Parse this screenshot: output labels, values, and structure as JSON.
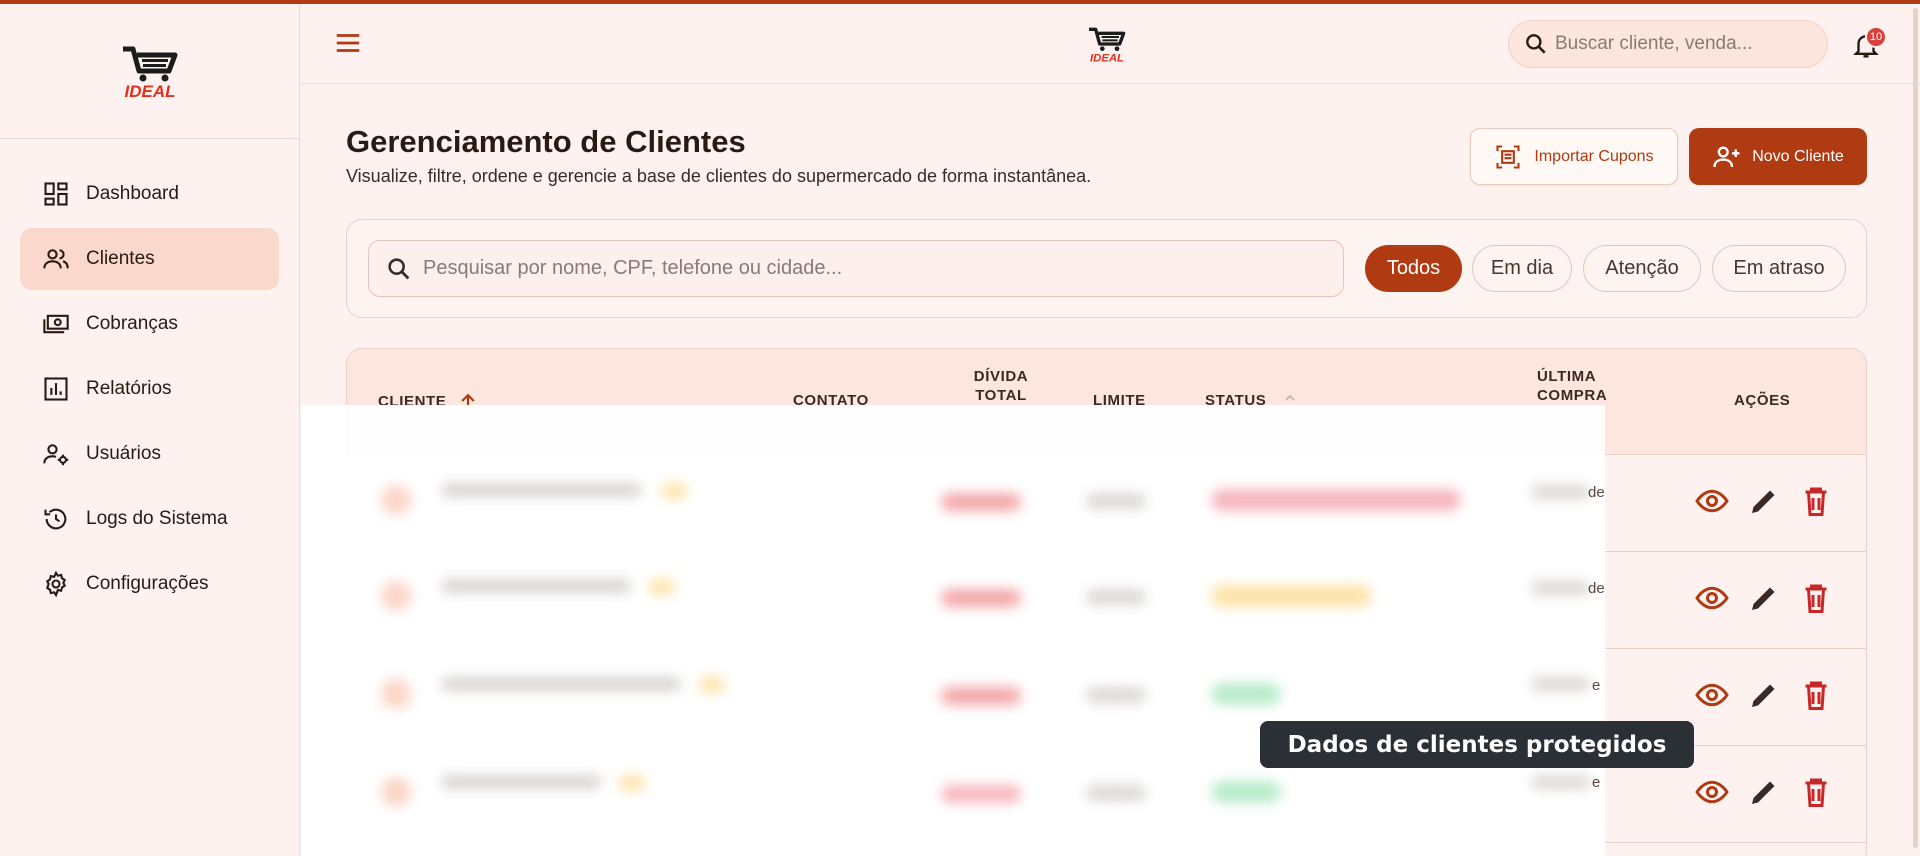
{
  "brand": {
    "logo_text": "IDEAL",
    "accent": "#b03a12"
  },
  "sidebar": {
    "items": [
      {
        "label": "Dashboard",
        "icon": "dashboard-icon",
        "active": false
      },
      {
        "label": "Clientes",
        "icon": "users-icon",
        "active": true
      },
      {
        "label": "Cobranças",
        "icon": "money-icon",
        "active": false
      },
      {
        "label": "Relatórios",
        "icon": "bar-chart-icon",
        "active": false
      },
      {
        "label": "Usuários",
        "icon": "user-settings-icon",
        "active": false
      },
      {
        "label": "Logs do Sistema",
        "icon": "history-icon",
        "active": false
      },
      {
        "label": "Configurações",
        "icon": "gear-icon",
        "active": false
      }
    ]
  },
  "header": {
    "search_placeholder": "Buscar cliente, venda...",
    "notifications_count": "10"
  },
  "page": {
    "title": "Gerenciamento de Clientes",
    "subtitle": "Visualize, filtre, ordene e gerencie a base de clientes do supermercado de forma instantânea.",
    "import_label": "Importar Cupons",
    "new_label": "Novo Cliente"
  },
  "filters": {
    "search_placeholder": "Pesquisar por nome, CPF, telefone ou cidade...",
    "chips": [
      "Todos",
      "Em dia",
      "Atenção",
      "Em atraso"
    ],
    "active": "Todos"
  },
  "table": {
    "columns": {
      "cliente": "CLIENTE",
      "contato": "CONTATO",
      "divida_1": "DÍVIDA",
      "divida_2": "TOTAL",
      "limite": "LIMITE",
      "status": "STATUS",
      "ultima_1": "ÚLTIMA",
      "ultima_2": "COMPRA",
      "acoes": "AÇÕES"
    },
    "peek_text": [
      "de",
      "de",
      "e",
      "e"
    ]
  },
  "tooltip": "Dados de clientes protegidos"
}
